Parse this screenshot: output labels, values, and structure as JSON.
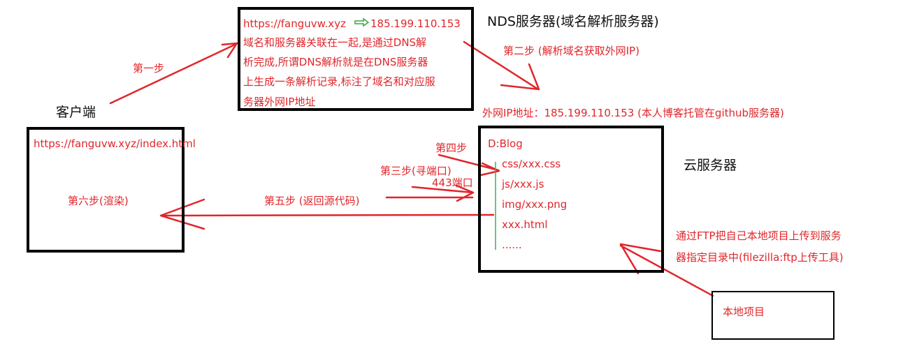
{
  "colors": {
    "annotation": "#e0262b",
    "ink": "#111111",
    "folder_line": "#38b24a",
    "dns_arrow": "#2faa3a"
  },
  "dns_box": {
    "url": "https://fanguvw.xyz",
    "ip": "185.199.110.153",
    "lines": [
      "域名和服务器关联在一起,是通过DNS解",
      "析完成,所谓DNS解析就是在DNS服务器",
      "上生成一条解析记录,标注了域名和对应服",
      "务器外网IP地址"
    ]
  },
  "dns_title": "NDS服务器(域名解析服务器)",
  "step2": "第二步 (解析域名获取外网IP)",
  "external_ip": "外网IP地址：185.199.110.153 (本人博客托管在github服务器)",
  "step1": "第一步",
  "client_label": "客户端",
  "client_box": {
    "url": "https://fanguvw.xyz/index.html",
    "step6": "第六步(渲染)"
  },
  "step5": "第五步 (返回源代码)",
  "step3": "第三步(寻端口)",
  "port": "443端口",
  "step4": "第四步",
  "server_box": {
    "root": "D:Blog",
    "files": [
      "css/xxx.css",
      "js/xxx.js",
      "img/xxx.png",
      "xxx.html",
      "......"
    ]
  },
  "cloud_label": "云服务器",
  "ftp_note": [
    "通过FTP把自己本地项目上传到服务",
    "器指定目录中(filezilla:ftp上传工具)"
  ],
  "local_box": {
    "label": "本地项目"
  }
}
